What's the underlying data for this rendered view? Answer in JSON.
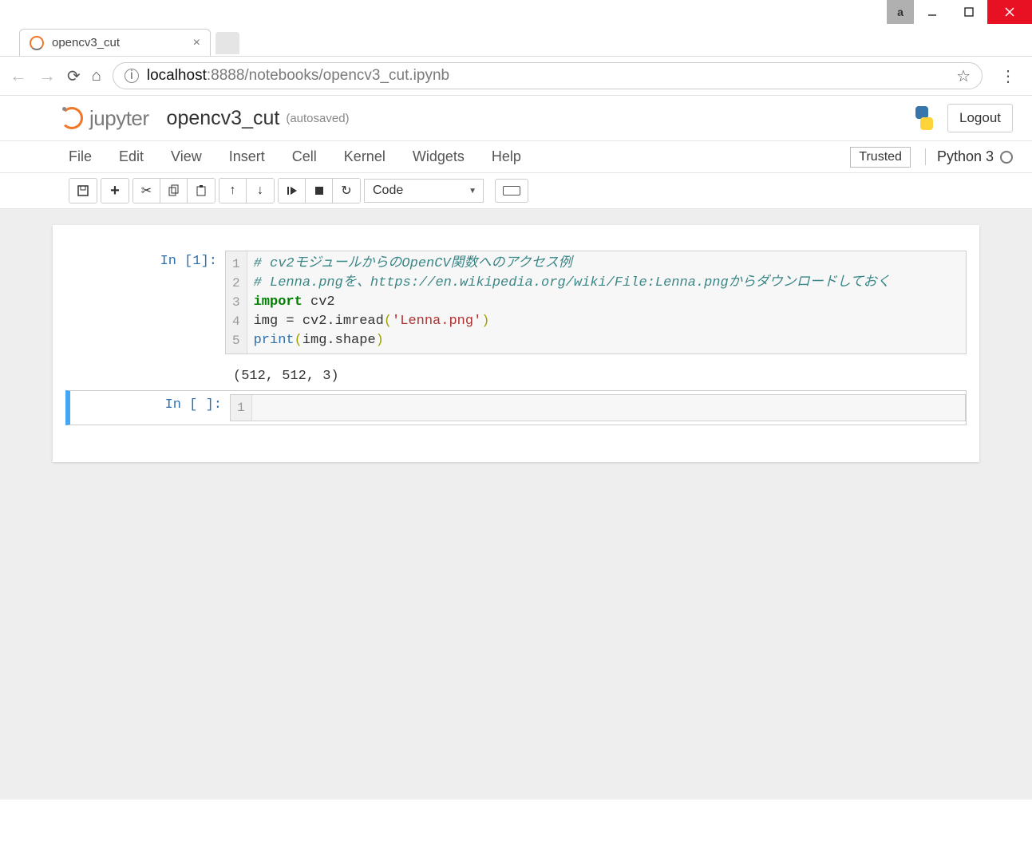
{
  "window": {
    "app_badge": "a"
  },
  "browser": {
    "tab_title": "opencv3_cut",
    "url_host": "localhost",
    "url_path": ":8888/notebooks/opencv3_cut.ipynb"
  },
  "jupyter": {
    "brand": "jupyter",
    "notebook_name": "opencv3_cut",
    "autosave": "(autosaved)",
    "logout": "Logout",
    "kernel_name": "Python 3",
    "trusted": "Trusted"
  },
  "menus": {
    "file": "File",
    "edit": "Edit",
    "view": "View",
    "insert": "Insert",
    "cell": "Cell",
    "kernel": "Kernel",
    "widgets": "Widgets",
    "help": "Help"
  },
  "toolbar": {
    "cell_type": "Code"
  },
  "cells": {
    "c1": {
      "prompt": "In [1]:",
      "gutter": "1\n2\n3\n4\n5",
      "line1": "# cv2モジュールからのOpenCV関数へのアクセス例",
      "line2": "# Lenna.pngを、https://en.wikipedia.org/wiki/File:Lenna.pngからダウンロードしておく",
      "line3a": "import",
      "line3b": " cv2",
      "line4a": "img = cv2.imread",
      "line4b": "(",
      "line4c": "'Lenna.png'",
      "line4d": ")",
      "line5a": "print",
      "line5b": "(",
      "line5c": "img.shape",
      "line5d": ")",
      "output": "(512, 512, 3)"
    },
    "c2": {
      "prompt": "In [ ]:",
      "gutter": "1"
    }
  }
}
